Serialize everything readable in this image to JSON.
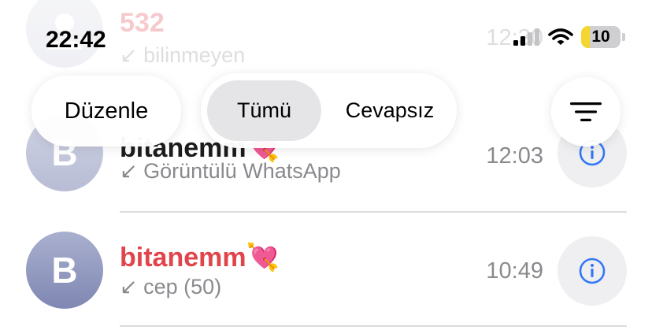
{
  "status_bar": {
    "time": "22:42",
    "battery": "10"
  },
  "toolbar": {
    "edit_label": "Düzenle",
    "filter_all": "Tümü",
    "filter_missed": "Cevapsız"
  },
  "calls": [
    {
      "name": "532",
      "detail": "bilinmeyen",
      "time": "12:30",
      "missed": true
    },
    {
      "name": "bitanemm",
      "emoji": "💘",
      "detail": "Görüntülü WhatsApp",
      "time": "12:03",
      "initial": "B",
      "missed": false
    },
    {
      "name": "bitanemm",
      "emoji": "💘",
      "detail": "cep (50)",
      "time": "10:49",
      "initial": "B",
      "missed": true
    }
  ],
  "colors": {
    "missed": "#e0454c",
    "accent": "#3478f6",
    "secondary": "#8a8a8e"
  }
}
